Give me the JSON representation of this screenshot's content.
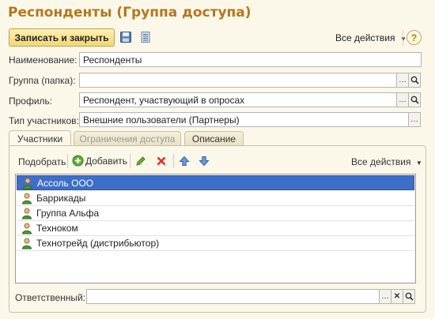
{
  "window": {
    "title": "Респонденты (Группа доступа)"
  },
  "toolbar": {
    "save_close_label": "Записать и закрыть",
    "all_actions_label": "Все действия",
    "help_label": "?"
  },
  "fields": {
    "name": {
      "label": "Наименование:",
      "value": "Респонденты"
    },
    "group": {
      "label": "Группа (папка):",
      "value": ""
    },
    "profile": {
      "label": "Профиль:",
      "value": "Респондент, участвующий в опросах"
    },
    "participants_type": {
      "label": "Тип участников:",
      "value": "Внешние пользователи (Партнеры)"
    },
    "responsible": {
      "label": "Ответственный:",
      "value": ""
    }
  },
  "tabs": [
    {
      "label": "Участники",
      "active": true
    },
    {
      "label": "Ограничения доступа",
      "disabled": true
    },
    {
      "label": "Описание"
    }
  ],
  "members_toolbar": {
    "pick_label": "Подобрать",
    "add_label": "Добавить",
    "all_actions_label": "Все действия"
  },
  "members": [
    {
      "name": "Ассоль ООО",
      "selected": true
    },
    {
      "name": "Баррикады"
    },
    {
      "name": "Группа Альфа"
    },
    {
      "name": "Техноком"
    },
    {
      "name": "Технотрейд (дистрибьютор)"
    }
  ],
  "colors": {
    "title": "#b6761c",
    "selection": "#3d6fc8",
    "background": "#fbf8ea"
  }
}
